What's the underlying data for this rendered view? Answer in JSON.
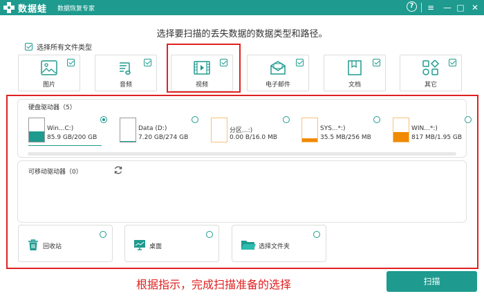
{
  "app": {
    "brand": "数据蛙",
    "subtitle": "数据恢复专家",
    "window_controls": [
      "?",
      "≡",
      "—",
      "□",
      "✕"
    ]
  },
  "headline": "选择要扫描的丢失数据的数据类型和路径。",
  "select_all_label": "选择所有文件类型",
  "file_types": [
    {
      "label": "图片",
      "icon": "image-icon",
      "checked": true
    },
    {
      "label": "音频",
      "icon": "music-icon",
      "checked": true
    },
    {
      "label": "视频",
      "icon": "video-icon",
      "checked": true
    },
    {
      "label": "电子邮件",
      "icon": "email-icon",
      "checked": true
    },
    {
      "label": "文档",
      "icon": "document-icon",
      "checked": true
    },
    {
      "label": "其它",
      "icon": "other-icon",
      "checked": true
    }
  ],
  "hard_drives": {
    "title": "硬盘驱动器（5）",
    "items": [
      {
        "name": "Win...C:)",
        "size": "85.9 GB/200 GB",
        "fill_pct": 43,
        "color": "#1e9a8f",
        "selected": true
      },
      {
        "name": "Data (D:)",
        "size": "7.20 GB/274 GB",
        "fill_pct": 3,
        "color": "#1e9a8f",
        "selected": false
      },
      {
        "name": "分区...:)",
        "size": "0.00  B/16.0 MB",
        "fill_pct": 0,
        "color": "#f08a00",
        "selected": false
      },
      {
        "name": "SYS...*:)",
        "size": "35.5 MB/256 MB",
        "fill_pct": 14,
        "color": "#f08a00",
        "selected": false
      },
      {
        "name": "WIN...*:)",
        "size": "817 MB/1.95 GB",
        "fill_pct": 42,
        "color": "#f08a00",
        "selected": false
      }
    ]
  },
  "removable": {
    "title": "可移动驱动器（0）"
  },
  "locations": [
    {
      "label": "回收站",
      "icon": "trash-icon"
    },
    {
      "label": "桌面",
      "icon": "desktop-icon"
    },
    {
      "label": "选择文件夹",
      "icon": "folder-icon"
    }
  ],
  "instruction": "根据指示，完成扫描准备的选择",
  "scan_button": "扫描",
  "colors": {
    "accent": "#1e9a8f",
    "warning": "#f08a00",
    "annotation": "#e02020"
  }
}
